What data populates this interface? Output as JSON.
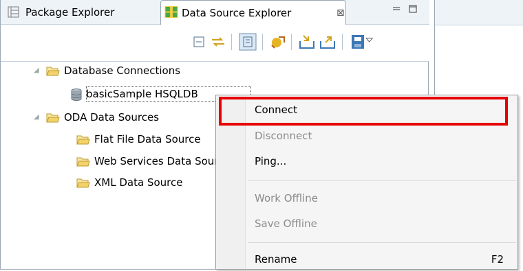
{
  "tabs": {
    "package_explorer": "Package Explorer",
    "data_source_explorer": "Data Source Explorer",
    "close_glyph": "⊠"
  },
  "tree": {
    "database_connections": "Database Connections",
    "basic_sample": "basicSample HSQLDB",
    "oda_data_sources": "ODA Data Sources",
    "flat_file": "Flat File Data Source",
    "web_services": "Web Services Data Source",
    "xml_data_source": "XML Data Source"
  },
  "menu": {
    "connect": "Connect",
    "disconnect": "Disconnect",
    "ping": "Ping...",
    "work_offline": "Work Offline",
    "save_offline": "Save Offline",
    "rename": "Rename",
    "rename_shortcut": "F2"
  },
  "colors": {
    "highlight": "#e60000",
    "folder": "#e8c25a",
    "toolbar_icon": "#3c78b4"
  }
}
